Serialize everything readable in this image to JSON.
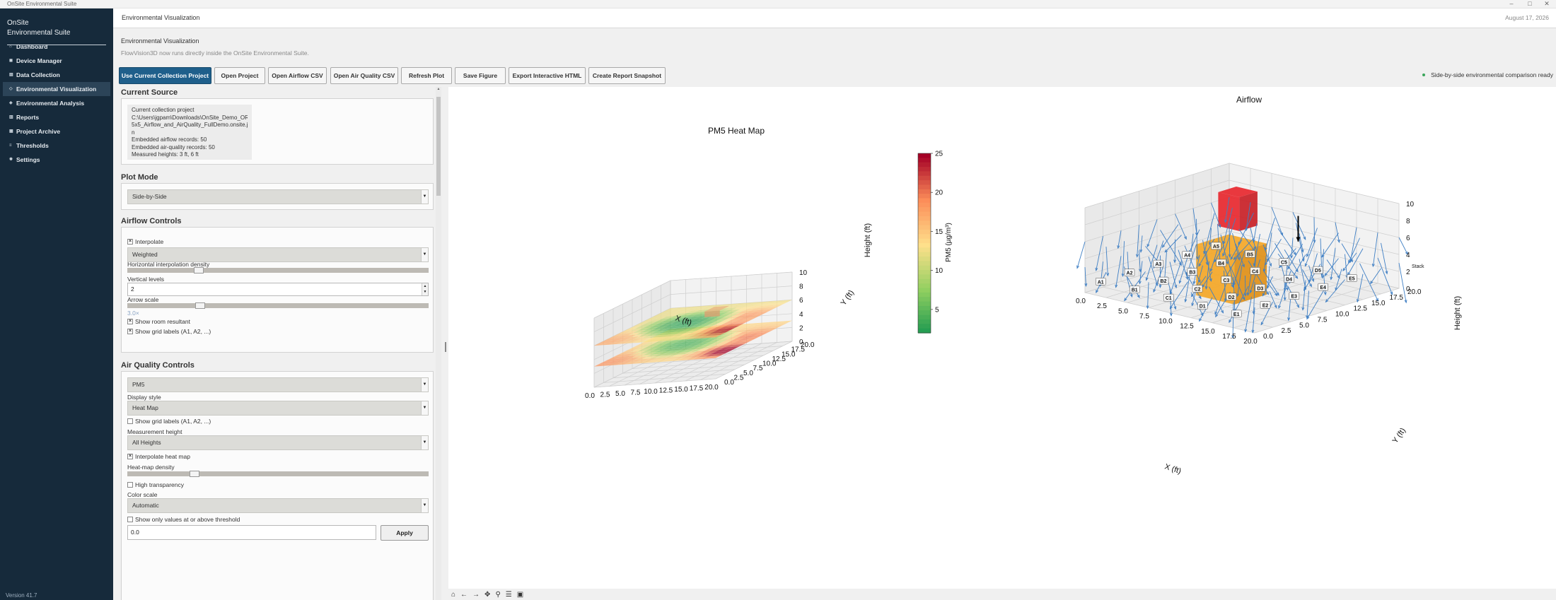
{
  "window": {
    "title": "OnSite Environmental Suite",
    "minimize": "–",
    "maximize": "□",
    "close": "✕"
  },
  "sidebar": {
    "brand_line1": "OnSite",
    "brand_line2": "Environmental Suite",
    "items": [
      {
        "label": "Dashboard",
        "icon": "home-icon"
      },
      {
        "label": "Device Manager",
        "icon": "device-icon"
      },
      {
        "label": "Data Collection",
        "icon": "data-icon"
      },
      {
        "label": "Environmental Visualization",
        "icon": "visualization-icon"
      },
      {
        "label": "Environmental Analysis",
        "icon": "analysis-icon"
      },
      {
        "label": "Reports",
        "icon": "reports-icon"
      },
      {
        "label": "Project Archive",
        "icon": "archive-icon"
      },
      {
        "label": "Thresholds",
        "icon": "thresholds-icon"
      },
      {
        "label": "Settings",
        "icon": "settings-icon"
      }
    ],
    "version": "Version 41.7"
  },
  "header": {
    "title": "Environmental Visualization",
    "date": "August 17, 2026"
  },
  "page": {
    "title": "Environmental Visualization",
    "subtitle": "FlowVision3D now runs directly inside the OnSite Environmental Suite."
  },
  "toolbar": {
    "buttons": [
      "Use Current Collection Project",
      "Open Project",
      "Open Airflow CSV",
      "Open Air Quality CSV",
      "Refresh Plot",
      "Save Figure",
      "Export Interactive HTML",
      "Create Report Snapshot"
    ],
    "status": "Side-by-side environmental comparison ready"
  },
  "current_source": {
    "title": "Current Source",
    "lines": [
      "Current collection project",
      "C:\\Users\\jgpam\\Downloads\\OnSite_Demo_OR_",
      "5x5_Airflow_and_AirQuality_FullDemo.onsite.jso",
      "n",
      "Embedded airflow records: 50",
      "Embedded air-quality records: 50",
      "Measured heights: 3 ft, 6 ft"
    ]
  },
  "plot_mode": {
    "title": "Plot Mode",
    "value": "Side-by-Side"
  },
  "airflow_controls": {
    "title": "Airflow Controls",
    "interpolate_label": "Interpolate",
    "interpolate_checked": true,
    "method": "Weighted",
    "h_density_label": "Horizontal interpolation density",
    "h_density_level": 0.24,
    "vertical_levels_label": "Vertical levels",
    "vertical_levels_value": "2",
    "arrow_scale_label": "Arrow scale",
    "arrow_scale_level": 0.24,
    "arrow_scale_value": "3.0×",
    "show_resultant_label": "Show room resultant",
    "show_resultant_checked": true,
    "show_grid_labels_label": "Show grid labels (A1, A2, ...)",
    "show_grid_labels_checked": true
  },
  "air_quality_controls": {
    "title": "Air Quality Controls",
    "pollutant": "PM5",
    "display_style_label": "Display style",
    "display_style": "Heat Map",
    "show_grid_labels_label": "Show grid labels (A1, A2, ...)",
    "show_grid_labels_checked": false,
    "measurement_height_label": "Measurement height",
    "measurement_height": "All Heights",
    "interpolate_heatmap_label": "Interpolate heat map",
    "interpolate_heatmap_checked": true,
    "heatmap_density_label": "Heat-map density",
    "heatmap_density_level": 0.22,
    "high_transparency_label": "High transparency",
    "high_transparency_checked": false,
    "color_scale_label": "Color scale",
    "color_scale": "Automatic",
    "threshold_only_label": "Show only values at or above threshold",
    "threshold_only_checked": false,
    "threshold_value": "0.0",
    "apply_label": "Apply"
  },
  "nav_toolbar": {
    "icons": [
      "home-icon",
      "back-icon",
      "forward-icon",
      "pan-icon",
      "zoom-icon",
      "configure-icon",
      "save-icon"
    ]
  },
  "chart_data": [
    {
      "type": "heatmap",
      "title": "PM5 Heat Map",
      "xlabel": "X (ft)",
      "ylabel": "Y (ft)",
      "zlabel": "Height (ft)",
      "x_ticks": [
        "0.0",
        "2.5",
        "5.0",
        "7.5",
        "10.0",
        "12.5",
        "15.0",
        "17.5",
        "20.0"
      ],
      "y_ticks": [
        "0.0",
        "2.5",
        "5.0",
        "7.5",
        "10.0",
        "12.5",
        "15.0",
        "17.5",
        "20.0"
      ],
      "z_ticks": [
        "0",
        "2",
        "4",
        "6",
        "8",
        "10"
      ],
      "xlim": [
        0,
        20
      ],
      "ylim": [
        0,
        20
      ],
      "zlim": [
        0,
        10
      ],
      "heights": [
        3,
        6
      ],
      "colorbar_label": "PM5 (µg/m³)",
      "colorbar_ticks": [
        "5",
        "10",
        "15",
        "20",
        "25"
      ],
      "colorbar_range": [
        2,
        25
      ],
      "colormap": "RdYlGn_r",
      "grid": true
    },
    {
      "type": "scatter",
      "title": "Airflow",
      "xlabel": "X (ft)",
      "ylabel": "Y (ft)",
      "zlabel": "Height (ft)",
      "x_ticks": [
        "0.0",
        "2.5",
        "5.0",
        "7.5",
        "10.0",
        "12.5",
        "15.0",
        "17.5",
        "20.0"
      ],
      "y_ticks": [
        "0.0",
        "2.5",
        "5.0",
        "7.5",
        "10.0",
        "12.5",
        "15.0",
        "17.5",
        "20.0"
      ],
      "z_ticks": [
        "0",
        "2",
        "4",
        "6",
        "8",
        "10"
      ],
      "xlim": [
        0,
        20
      ],
      "ylim": [
        0,
        20
      ],
      "zlim": [
        0,
        10
      ],
      "grid_labels": [
        "A1",
        "A2",
        "A3",
        "A4",
        "A5",
        "B1",
        "B2",
        "B3",
        "B4",
        "B5",
        "C1",
        "C2",
        "C3",
        "C4",
        "C5",
        "D1",
        "D2",
        "D3",
        "D4",
        "D5",
        "E1",
        "E2",
        "E3",
        "E4",
        "E5"
      ],
      "obstacles": [
        {
          "label": "Stack",
          "color": "#e8232a"
        },
        {
          "label": "",
          "color": "#f5a623"
        }
      ],
      "arrow_color": "#3f7fc4",
      "resultant_color": "#000000",
      "grid": true
    }
  ]
}
